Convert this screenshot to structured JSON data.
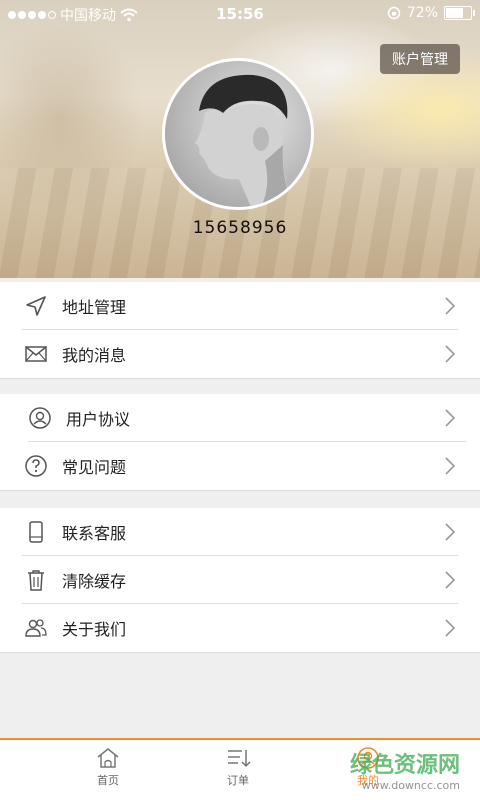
{
  "status_bar": {
    "carrier": "中国移动",
    "time": "15:56",
    "battery_percent": "72%",
    "battery_level": 0.72
  },
  "header": {
    "account_button": "账户管理",
    "username": "15658956"
  },
  "menu_groups": [
    [
      {
        "label": "地址管理",
        "icon": "location-arrow-icon"
      },
      {
        "label": "我的消息",
        "icon": "envelope-icon"
      }
    ],
    [
      {
        "label": "用户协议",
        "icon": "user-circle-icon"
      },
      {
        "label": "常见问题",
        "icon": "question-circle-icon"
      }
    ],
    [
      {
        "label": "联系客服",
        "icon": "phone-icon"
      },
      {
        "label": "清除缓存",
        "icon": "trash-icon"
      },
      {
        "label": "关于我们",
        "icon": "users-icon"
      }
    ]
  ],
  "tab_bar": {
    "tabs": [
      {
        "label": "首页",
        "icon": "home-icon",
        "active": false
      },
      {
        "label": "订单",
        "icon": "order-list-icon",
        "active": false
      },
      {
        "label": "我的",
        "icon": "profile-icon",
        "active": true
      }
    ]
  },
  "watermark": {
    "title": "绿色资源网",
    "url": "www.downcc.com"
  },
  "colors": {
    "accent": "#f08a2c",
    "background": "#efefef"
  }
}
